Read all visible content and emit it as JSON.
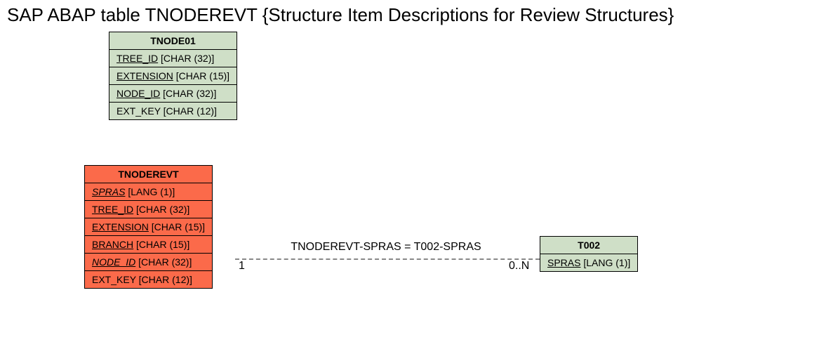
{
  "title": "SAP ABAP table TNODEREVT {Structure Item Descriptions for Review Structures}",
  "tables": {
    "tnode01": {
      "name": "TNODE01",
      "fields": [
        {
          "name": "TREE_ID",
          "type": "[CHAR (32)]",
          "underline": true,
          "italic": false
        },
        {
          "name": "EXTENSION",
          "type": "[CHAR (15)]",
          "underline": true,
          "italic": false
        },
        {
          "name": "NODE_ID",
          "type": "[CHAR (32)]",
          "underline": true,
          "italic": false
        },
        {
          "name": "EXT_KEY",
          "type": "[CHAR (12)]",
          "underline": false,
          "italic": false
        }
      ]
    },
    "tnoderevt": {
      "name": "TNODEREVT",
      "fields": [
        {
          "name": "SPRAS",
          "type": "[LANG (1)]",
          "underline": true,
          "italic": true
        },
        {
          "name": "TREE_ID",
          "type": "[CHAR (32)]",
          "underline": true,
          "italic": false
        },
        {
          "name": "EXTENSION",
          "type": "[CHAR (15)]",
          "underline": true,
          "italic": false
        },
        {
          "name": "BRANCH",
          "type": "[CHAR (15)]",
          "underline": true,
          "italic": false
        },
        {
          "name": "NODE_ID",
          "type": "[CHAR (32)]",
          "underline": true,
          "italic": true
        },
        {
          "name": "EXT_KEY",
          "type": "[CHAR (12)]",
          "underline": false,
          "italic": false
        }
      ]
    },
    "t002": {
      "name": "T002",
      "fields": [
        {
          "name": "SPRAS",
          "type": "[LANG (1)]",
          "underline": true,
          "italic": false
        }
      ]
    }
  },
  "relation": {
    "label": "TNODEREVT-SPRAS = T002-SPRAS",
    "left_card": "1",
    "right_card": "0..N"
  },
  "chart_data": {
    "type": "table",
    "title": "SAP ABAP table TNODEREVT {Structure Item Descriptions for Review Structures}",
    "entities": [
      {
        "name": "TNODE01",
        "color": "green",
        "fields": [
          {
            "name": "TREE_ID",
            "type": "CHAR (32)",
            "key": true
          },
          {
            "name": "EXTENSION",
            "type": "CHAR (15)",
            "key": true
          },
          {
            "name": "NODE_ID",
            "type": "CHAR (32)",
            "key": true
          },
          {
            "name": "EXT_KEY",
            "type": "CHAR (12)",
            "key": false
          }
        ]
      },
      {
        "name": "TNODEREVT",
        "color": "orange",
        "fields": [
          {
            "name": "SPRAS",
            "type": "LANG (1)",
            "key": true,
            "fk": true
          },
          {
            "name": "TREE_ID",
            "type": "CHAR (32)",
            "key": true
          },
          {
            "name": "EXTENSION",
            "type": "CHAR (15)",
            "key": true
          },
          {
            "name": "BRANCH",
            "type": "CHAR (15)",
            "key": true
          },
          {
            "name": "NODE_ID",
            "type": "CHAR (32)",
            "key": true,
            "fk": true
          },
          {
            "name": "EXT_KEY",
            "type": "CHAR (12)",
            "key": false
          }
        ]
      },
      {
        "name": "T002",
        "color": "green",
        "fields": [
          {
            "name": "SPRAS",
            "type": "LANG (1)",
            "key": true
          }
        ]
      }
    ],
    "relations": [
      {
        "from": "TNODEREVT",
        "to": "T002",
        "label": "TNODEREVT-SPRAS = T002-SPRAS",
        "cardinality_from": "1",
        "cardinality_to": "0..N"
      }
    ]
  }
}
